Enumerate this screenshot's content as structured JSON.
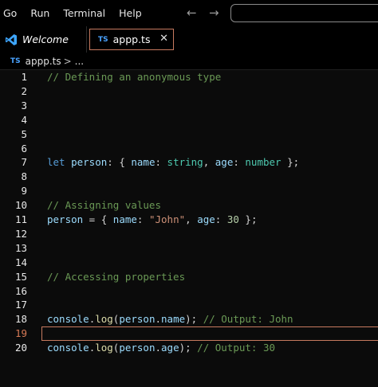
{
  "menubar": {
    "items": [
      "Go",
      "Run",
      "Terminal",
      "Help"
    ],
    "back_glyph": "←",
    "forward_glyph": "→"
  },
  "tabs": {
    "welcome_label": "Welcome",
    "file_badge": "TS",
    "file_label": "appp.ts",
    "close_glyph": "✕"
  },
  "breadcrumb": {
    "badge": "TS",
    "file": "appp.ts",
    "separator": ">",
    "more": "..."
  },
  "editor": {
    "active_line": 19,
    "lines": [
      {
        "n": "1",
        "tokens": [
          {
            "t": "// Defining an anonymous type",
            "c": "cm"
          }
        ]
      },
      {
        "n": "2",
        "tokens": []
      },
      {
        "n": "3",
        "tokens": []
      },
      {
        "n": "4",
        "tokens": []
      },
      {
        "n": "5",
        "tokens": []
      },
      {
        "n": "6",
        "tokens": []
      },
      {
        "n": "7",
        "tokens": [
          {
            "t": "let",
            "c": "kw"
          },
          {
            "t": " ",
            "c": "pn"
          },
          {
            "t": "person",
            "c": "var"
          },
          {
            "t": ": { ",
            "c": "pn"
          },
          {
            "t": "name",
            "c": "prop"
          },
          {
            "t": ": ",
            "c": "pn"
          },
          {
            "t": "string",
            "c": "ty"
          },
          {
            "t": ", ",
            "c": "pn"
          },
          {
            "t": "age",
            "c": "prop"
          },
          {
            "t": ": ",
            "c": "pn"
          },
          {
            "t": "number",
            "c": "ty"
          },
          {
            "t": " };",
            "c": "pn"
          }
        ]
      },
      {
        "n": "8",
        "tokens": []
      },
      {
        "n": "9",
        "tokens": []
      },
      {
        "n": "10",
        "tokens": [
          {
            "t": "// Assigning values",
            "c": "cm"
          }
        ]
      },
      {
        "n": "11",
        "tokens": [
          {
            "t": "person",
            "c": "var"
          },
          {
            "t": " = { ",
            "c": "pn"
          },
          {
            "t": "name",
            "c": "prop"
          },
          {
            "t": ": ",
            "c": "pn"
          },
          {
            "t": "\"John\"",
            "c": "str"
          },
          {
            "t": ", ",
            "c": "pn"
          },
          {
            "t": "age",
            "c": "prop"
          },
          {
            "t": ": ",
            "c": "pn"
          },
          {
            "t": "30",
            "c": "num"
          },
          {
            "t": " };",
            "c": "pn"
          }
        ]
      },
      {
        "n": "12",
        "tokens": []
      },
      {
        "n": "13",
        "tokens": []
      },
      {
        "n": "14",
        "tokens": []
      },
      {
        "n": "15",
        "tokens": [
          {
            "t": "// Accessing properties",
            "c": "cm"
          }
        ]
      },
      {
        "n": "16",
        "tokens": []
      },
      {
        "n": "17",
        "tokens": []
      },
      {
        "n": "18",
        "tokens": [
          {
            "t": "console",
            "c": "var"
          },
          {
            "t": ".",
            "c": "pn"
          },
          {
            "t": "log",
            "c": "fn"
          },
          {
            "t": "(",
            "c": "pn"
          },
          {
            "t": "person",
            "c": "var"
          },
          {
            "t": ".",
            "c": "pn"
          },
          {
            "t": "name",
            "c": "prop"
          },
          {
            "t": "); ",
            "c": "pn"
          },
          {
            "t": "// Output: John",
            "c": "cm"
          }
        ]
      },
      {
        "n": "19",
        "tokens": []
      },
      {
        "n": "20",
        "tokens": [
          {
            "t": "console",
            "c": "var"
          },
          {
            "t": ".",
            "c": "pn"
          },
          {
            "t": "log",
            "c": "fn"
          },
          {
            "t": "(",
            "c": "pn"
          },
          {
            "t": "person",
            "c": "var"
          },
          {
            "t": ".",
            "c": "pn"
          },
          {
            "t": "age",
            "c": "prop"
          },
          {
            "t": "); ",
            "c": "pn"
          },
          {
            "t": "// Output: 30",
            "c": "cm"
          }
        ]
      }
    ]
  },
  "colors": {
    "background": "#0b0b0b",
    "comment": "#6a9955",
    "keyword": "#569cd6",
    "variable": "#9cdcfe",
    "type": "#4ec9b0",
    "string": "#ce9178",
    "number": "#b5cea8",
    "function": "#dcdcaa",
    "active_border": "#c77a5f",
    "ts_badge": "#4aa3ff"
  }
}
